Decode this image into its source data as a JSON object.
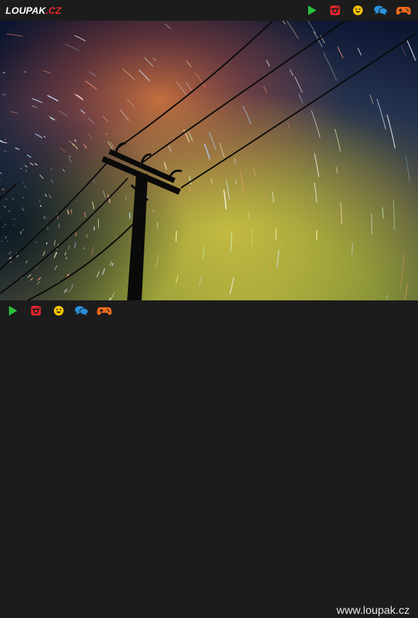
{
  "header": {
    "logo": {
      "part1": "LOUPAK",
      "part2": ".CZ"
    },
    "icons": [
      {
        "name": "play-icon",
        "color": "#2bbf3a"
      },
      {
        "name": "instagram-icon",
        "color": "#e8262c"
      },
      {
        "name": "smiley-icon",
        "color": "#f5c400"
      },
      {
        "name": "chat-icon",
        "color": "#2a8fd8"
      },
      {
        "name": "gamepad-icon",
        "color": "#f26b1d"
      }
    ]
  },
  "photo": {
    "subject": "star trails over power line pole",
    "colors": {
      "sky_top": "#0a1530",
      "sky_mid": "#2a3a5a",
      "glow_orange": "#e07a3a",
      "glow_yellow": "#c8b53a",
      "glow_green": "#6a8a2a",
      "silhouette": "#0a0a0a"
    }
  },
  "footer": {
    "icons": [
      {
        "name": "play-icon",
        "color": "#2bbf3a"
      },
      {
        "name": "instagram-icon",
        "color": "#e8262c"
      },
      {
        "name": "smiley-icon",
        "color": "#f5c400"
      },
      {
        "name": "chat-icon",
        "color": "#2a8fd8"
      },
      {
        "name": "gamepad-icon",
        "color": "#f26b1d"
      }
    ],
    "site_url": "www.loupak.cz"
  }
}
